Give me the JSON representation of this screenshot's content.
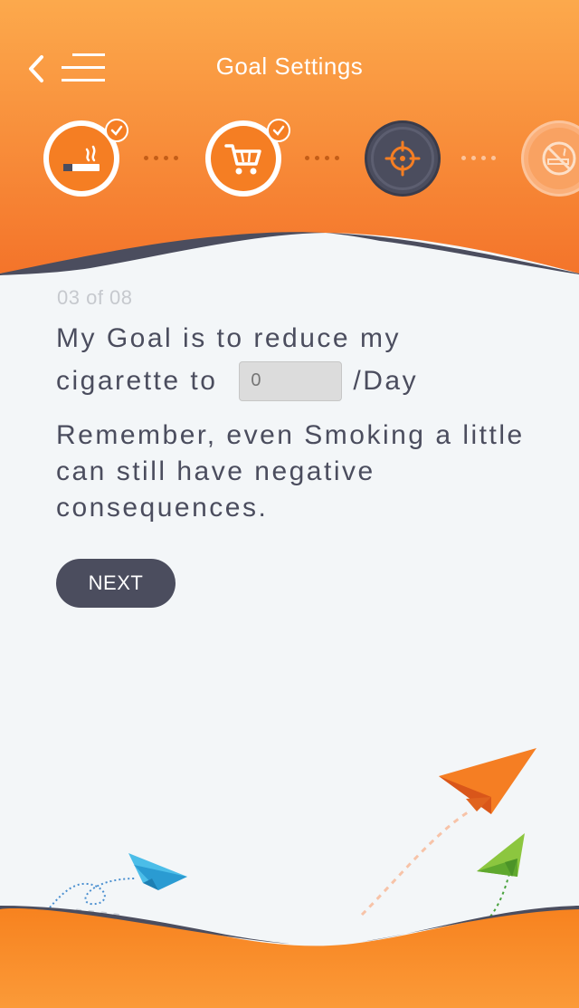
{
  "header": {
    "title": "Goal Settings",
    "back_icon": "chevron-left-icon",
    "menu_icon": "hamburger-menu-icon"
  },
  "steps": [
    {
      "name": "smoking",
      "icon": "cigarette-icon",
      "state": "completed"
    },
    {
      "name": "shopping",
      "icon": "cart-icon",
      "state": "completed"
    },
    {
      "name": "goal",
      "icon": "target-icon",
      "state": "current"
    },
    {
      "name": "quit",
      "icon": "no-smoking-icon",
      "state": "upcoming"
    }
  ],
  "content": {
    "progress": "03 of 08",
    "goal_line1": "My Goal is to reduce my",
    "goal_line2_prefix": "cigarette to",
    "goal_input_placeholder": "0",
    "goal_line2_suffix": "/Day",
    "remember": "Remember, even Smoking a little can still have negative consequences.",
    "next_label": "NEXT"
  },
  "colors": {
    "orange": "#f57e23",
    "orange_light": "#fba94f",
    "dark": "#4b4d5e",
    "background": "#f3f6f8"
  }
}
